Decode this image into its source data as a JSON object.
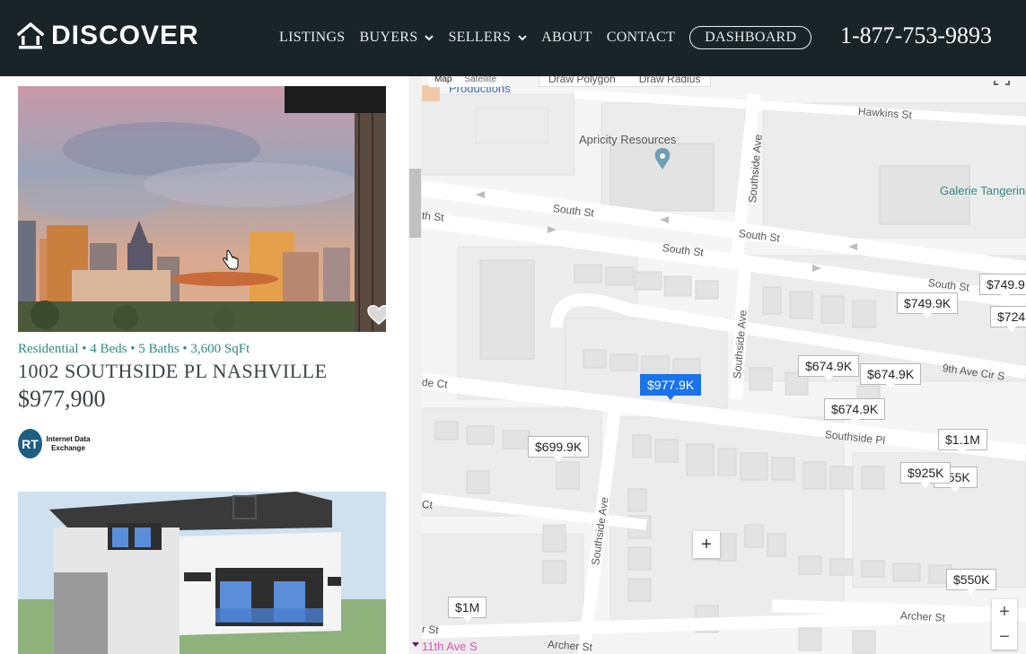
{
  "header": {
    "logo_text": "DISCOVER",
    "nav": {
      "listings": "LISTINGS",
      "buyers": "BUYERS",
      "sellers": "SELLERS",
      "about": "ABOUT",
      "contact": "CONTACT",
      "dashboard": "DASHBOARD"
    },
    "phone": "1-877-753-9893"
  },
  "listing": {
    "meta": "Residential • 4 Beds • 5 Baths • 3,600 SqFt",
    "address": "1002 SOUTHSIDE PL NASHVILLE",
    "price": "$977,900",
    "idx_logo_text": "Internet Data Exchange",
    "idx_initials": "RT"
  },
  "map": {
    "type_map": "Map",
    "type_satellite": "Satellite",
    "draw_polygon": "Draw Polygon",
    "draw_radius": "Draw Radius",
    "zoom_in": "+",
    "zoom_out": "−",
    "add": "+",
    "pois": {
      "apricity": "Apricity Resources",
      "galerie": "Galerie Tangerin",
      "productions": "Productions",
      "eleventh": "11th Ave S"
    },
    "streets": {
      "hawkins": "Hawkins St",
      "south1": "South St",
      "south2": "South St",
      "south3": "South St",
      "south4": "South St",
      "st": "th St",
      "southside_ave1": "Southside Ave",
      "southside_ave2": "Southside Ave",
      "southside_ave3": "Southside Ave",
      "ninth": "9th Ave Cir S",
      "de_ct": "de Ct",
      "southside_pl": "Southside Pl",
      "ct": "Ct",
      "archer1": "Archer St",
      "archer2": "Archer St",
      "st2": "r St"
    },
    "pins": [
      {
        "label": "$749.9K"
      },
      {
        "label": "$749.9"
      },
      {
        "label": "$724"
      },
      {
        "label": "$674.9K"
      },
      {
        "label": "$674.9K"
      },
      {
        "label": "$977.9K"
      },
      {
        "label": "$674.9K"
      },
      {
        "label": "$1.1M"
      },
      {
        "label": "$699.9K"
      },
      {
        "label": "$925K"
      },
      {
        "label": "$55K"
      },
      {
        "label": "$550K"
      },
      {
        "label": "$1M"
      }
    ]
  },
  "colors": {
    "header_bg": "#182428",
    "accent_teal": "#2e8a80",
    "active_pin": "#1a73e8"
  }
}
